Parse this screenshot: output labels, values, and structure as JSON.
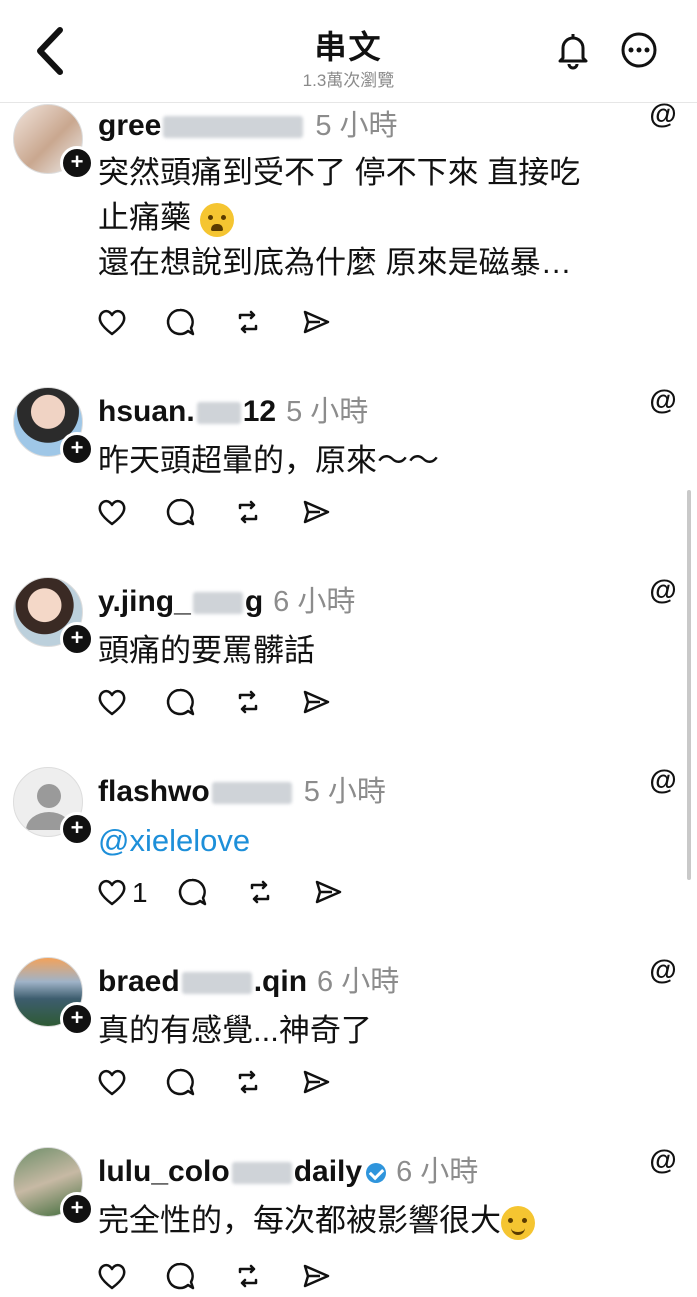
{
  "header": {
    "title": "串文",
    "views": "1.3萬次瀏覽"
  },
  "posts": [
    {
      "username": "gree",
      "time": "5 小時",
      "lines": [
        "突然頭痛到受不了 停不下來 直接吃",
        "止痛藥 ",
        "還在想說到底為什麼 原來是磁暴…"
      ]
    },
    {
      "username": "hsuan.",
      "username_tail": "12",
      "time": "5 小時",
      "lines": [
        "昨天頭超暈的，原來～～"
      ]
    },
    {
      "username": "y.jing_",
      "username_tail": "g",
      "time": "6 小時",
      "lines": [
        "頭痛的要罵髒話"
      ]
    },
    {
      "username": "flashwo",
      "time": "5 小時",
      "mention": "@xielelove",
      "likes": "1"
    },
    {
      "username": "braed",
      "username_tail": ".qin",
      "time": "6 小時",
      "lines": [
        "真的有感覺...神奇了"
      ]
    },
    {
      "username": "lulu_colo",
      "username_tail": "daily",
      "time": "6 小時",
      "lines": [
        "完全性的，每次都被影響很大"
      ]
    }
  ],
  "icons": [
    "back-chevron-icon",
    "bell-icon",
    "more-icon",
    "threads-logo-icon",
    "heart-icon",
    "comment-icon",
    "repost-icon",
    "share-icon"
  ]
}
